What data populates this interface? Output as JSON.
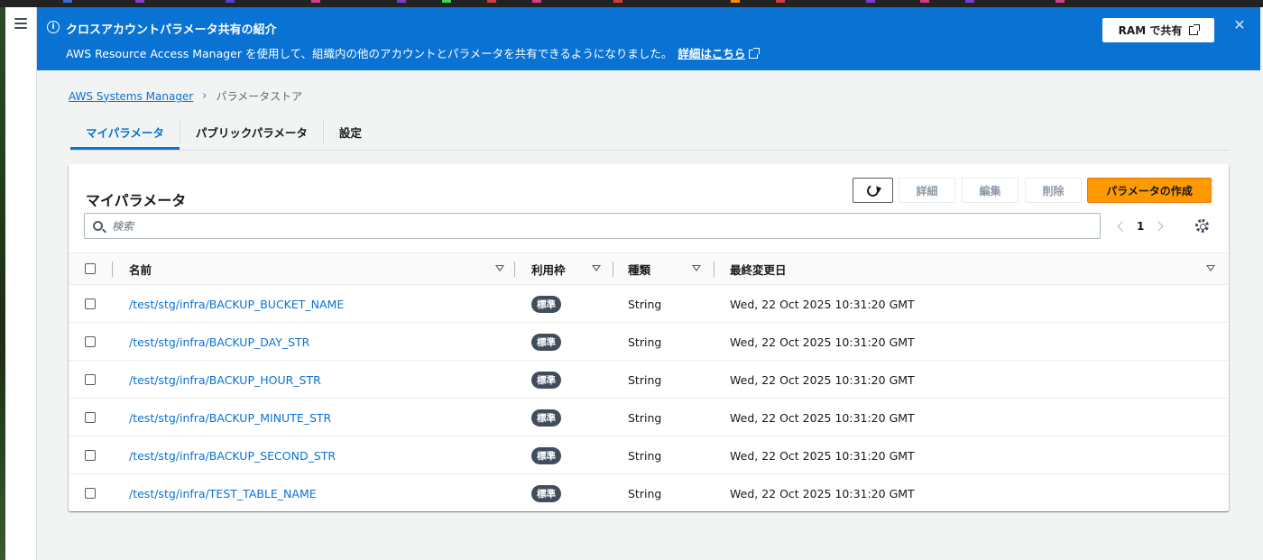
{
  "flash": {
    "title": "クロスアカウントパラメータ共有の紹介",
    "text": "AWS Resource Access Manager を使用して、組織内の他のアカウントとパラメータを共有できるようになりました。",
    "link": "詳細はこちら",
    "ram_button": "RAM で共有",
    "color": "#0972d3"
  },
  "breadcrumb": {
    "parent": "AWS Systems Manager",
    "current": "パラメータストア"
  },
  "tabs": [
    {
      "label": "マイパラメータ",
      "active": true
    },
    {
      "label": "パブリックパラメータ",
      "active": false
    },
    {
      "label": "設定",
      "active": false
    }
  ],
  "panel": {
    "title": "マイパラメータ",
    "buttons": {
      "details": "詳細",
      "edit": "編集",
      "delete": "削除",
      "create": "パラメータの作成"
    },
    "search_placeholder": "検索",
    "page": "1"
  },
  "table": {
    "columns": {
      "name": "名前",
      "tier": "利用枠",
      "type": "種類",
      "last_modified": "最終変更日"
    },
    "rows": [
      {
        "name": "/test/stg/infra/BACKUP_BUCKET_NAME",
        "tier": "標準",
        "type": "String",
        "last_modified": "Wed, 22 Oct 2025 10:31:20 GMT"
      },
      {
        "name": "/test/stg/infra/BACKUP_DAY_STR",
        "tier": "標準",
        "type": "String",
        "last_modified": "Wed, 22 Oct 2025 10:31:20 GMT"
      },
      {
        "name": "/test/stg/infra/BACKUP_HOUR_STR",
        "tier": "標準",
        "type": "String",
        "last_modified": "Wed, 22 Oct 2025 10:31:20 GMT"
      },
      {
        "name": "/test/stg/infra/BACKUP_MINUTE_STR",
        "tier": "標準",
        "type": "String",
        "last_modified": "Wed, 22 Oct 2025 10:31:20 GMT"
      },
      {
        "name": "/test/stg/infra/BACKUP_SECOND_STR",
        "tier": "標準",
        "type": "String",
        "last_modified": "Wed, 22 Oct 2025 10:31:20 GMT"
      },
      {
        "name": "/test/stg/infra/TEST_TABLE_NAME",
        "tier": "標準",
        "type": "String",
        "last_modified": "Wed, 22 Oct 2025 10:31:20 GMT"
      }
    ]
  },
  "colors": {
    "accent": "#0972d3",
    "primary_button": "#ff9900",
    "badge": "#414d5c"
  }
}
